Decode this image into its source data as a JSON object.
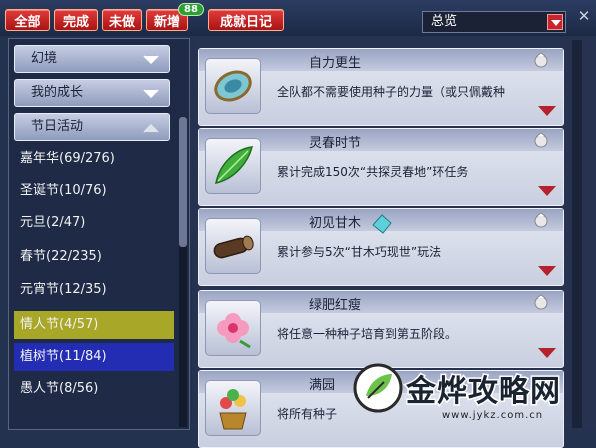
{
  "toolbar": {
    "buttons": [
      "全部",
      "完成",
      "未做",
      "新增"
    ],
    "new_badge": "88",
    "diary_button": "成就日记",
    "filter_value": "总览",
    "close_glyph": "✕"
  },
  "sidebar": {
    "categories": [
      "幻境",
      "我的成长",
      "节日活动"
    ],
    "items": [
      "嘉年华(69/276)",
      "圣诞节(10/76)",
      "元旦(2/47)",
      "春节(22/235)",
      "元宵节(12/35)",
      "情人节(4/57)",
      "植树节(11/84)",
      "愚人节(8/56)"
    ]
  },
  "achievements": [
    {
      "title": "自力更生",
      "desc": "全队都不需要使用种子的力量（或只佩戴种",
      "icon": "shield-icon"
    },
    {
      "title": "灵春时节",
      "desc": "累计完成150次“共探灵春地”环任务",
      "icon": "leaf-icon"
    },
    {
      "title": "初见甘木",
      "desc": "累计参与5次“甘木巧现世”玩法",
      "icon": "log-icon"
    },
    {
      "title": "绿肥红瘦",
      "desc": "将任意一种种子培育到第五阶段。",
      "icon": "flower-icon"
    },
    {
      "title": "满园",
      "desc": "将所有种子",
      "icon": "plant-pot-icon"
    }
  ],
  "watermark": {
    "text": "金烨攻略网",
    "url": "www.jykz.com.cn"
  },
  "colors": {
    "button_red": "#c9242c",
    "badge_green": "#2f9e38",
    "selected_yellow": "#a9a728",
    "selected_blue": "#232db3"
  }
}
